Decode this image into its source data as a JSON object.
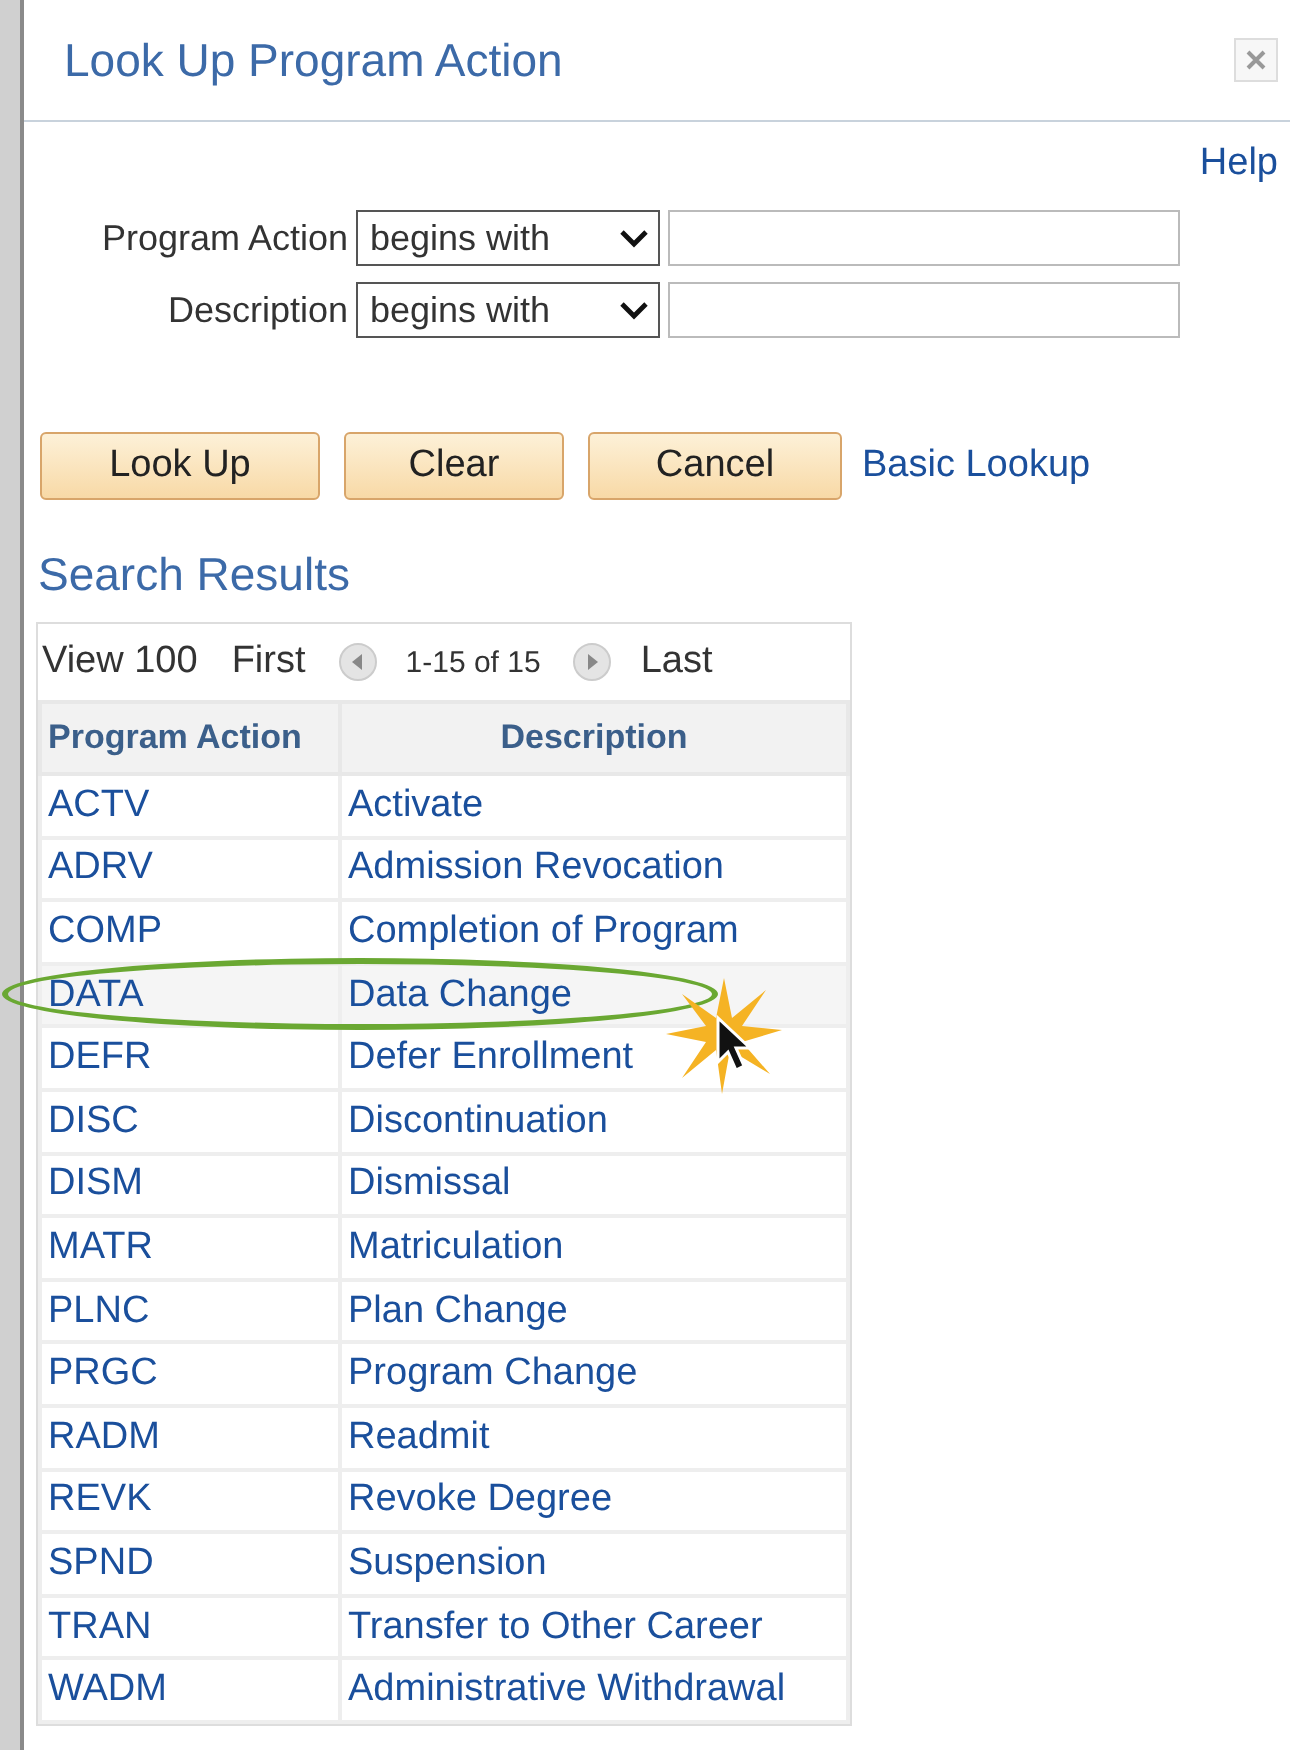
{
  "window": {
    "title": "Look Up Program Action"
  },
  "help_link": "Help",
  "criteria": [
    {
      "label": "Program Action",
      "operator": "begins with"
    },
    {
      "label": "Description",
      "operator": "begins with"
    }
  ],
  "buttons": [
    "Look Up",
    "Clear",
    "Cancel"
  ],
  "basic_lookup_link": "Basic Lookup",
  "results": {
    "title": "Search Results",
    "pager": {
      "view": "View 100",
      "first": "First",
      "range": "1-15 of 15",
      "last": "Last"
    },
    "columns": [
      "Program Action",
      "Description"
    ],
    "rows": [
      {
        "code": "ACTV",
        "description": "Activate",
        "circled": false
      },
      {
        "code": "ADRV",
        "description": "Admission Revocation",
        "circled": false
      },
      {
        "code": "COMP",
        "description": "Completion of Program",
        "circled": false
      },
      {
        "code": "DATA",
        "description": "Data Change",
        "circled": true
      },
      {
        "code": "DEFR",
        "description": "Defer Enrollment",
        "circled": false
      },
      {
        "code": "DISC",
        "description": "Discontinuation",
        "circled": false
      },
      {
        "code": "DISM",
        "description": "Dismissal",
        "circled": false
      },
      {
        "code": "MATR",
        "description": "Matriculation",
        "circled": false
      },
      {
        "code": "PLNC",
        "description": "Plan Change",
        "circled": false
      },
      {
        "code": "PRGC",
        "description": "Program Change",
        "circled": false
      },
      {
        "code": "RADM",
        "description": "Readmit",
        "circled": false
      },
      {
        "code": "REVK",
        "description": "Revoke Degree",
        "circled": false
      },
      {
        "code": "SPND",
        "description": "Suspension",
        "circled": false
      },
      {
        "code": "TRAN",
        "description": "Transfer to Other Career",
        "circled": false
      },
      {
        "code": "WADM",
        "description": "Administrative Withdrawal",
        "circled": false
      }
    ]
  }
}
